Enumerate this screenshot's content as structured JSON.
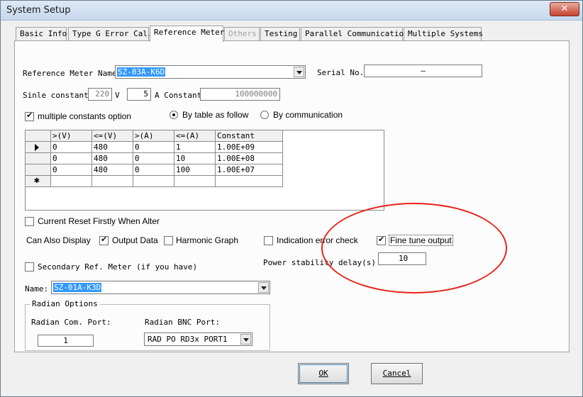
{
  "window": {
    "title": "System Setup",
    "close_symbol": "✕"
  },
  "tabs": [
    {
      "label": "Basic Info",
      "state": "normal"
    },
    {
      "label": "Type G Error Cal.",
      "state": "normal"
    },
    {
      "label": "Reference Meter",
      "state": "active"
    },
    {
      "label": "Others",
      "state": "disabled"
    },
    {
      "label": "Testing",
      "state": "normal"
    },
    {
      "label": "Parallel Communication",
      "state": "normal"
    },
    {
      "label": "Multiple Systems",
      "state": "normal"
    }
  ],
  "ref_meter": {
    "name_label": "Reference Meter Name",
    "name_value": "SZ-03A-K6D",
    "serial_label": "Serial No.",
    "serial_value": "—"
  },
  "constants": {
    "sinle_label": "Sinle constant",
    "v_value": "220",
    "v_unit": "V",
    "a_value": "5",
    "a_constant_label": "A Constant",
    "a_constant_value": "100000000"
  },
  "options": {
    "multiple_constants_label": "multiple constants option",
    "multiple_constants_checked": true,
    "by_table_label": "By table as follow",
    "by_table_selected": true,
    "by_comm_label": "By communication",
    "by_comm_selected": false
  },
  "table": {
    "headers": [
      ">(V)",
      "<=(V)",
      ">(A)",
      "<=(A)",
      "Constant"
    ],
    "rows": [
      [
        "0",
        "480",
        "0",
        "1",
        "1.00E+09"
      ],
      [
        "0",
        "480",
        "0",
        "10",
        "1.00E+08"
      ],
      [
        "0",
        "480",
        "0",
        "100",
        "1.00E+07"
      ]
    ],
    "new_row_marker": "✱"
  },
  "reset": {
    "label": "Current Reset Firstly When Alter",
    "checked": false
  },
  "display": {
    "can_also_display_label": "Can Also Display",
    "output_data_label": "Output Data",
    "output_data_checked": true,
    "harmonic_graph_label": "Harmonic Graph",
    "harmonic_graph_checked": false,
    "indication_error_label": "Indication error check",
    "indication_error_checked": false,
    "fine_tune_label": "Fine tune output",
    "fine_tune_checked": true
  },
  "power_stability": {
    "label": "Power stability delay(s)",
    "value": "10"
  },
  "secondary": {
    "label": "Secondary Ref. Meter (if you have)",
    "checked": false,
    "name_label": "Name:",
    "name_value": "SZ-01A-K3D"
  },
  "radian": {
    "group_title": "Radian Options",
    "com_port_label": "Radian Com. Port:",
    "com_port_value": "1",
    "bnc_port_label": "Radian BNC Port:",
    "bnc_port_value": "RAD PO RD3x PORT1"
  },
  "buttons": {
    "ok": "OK",
    "cancel": "Cancel"
  },
  "colors": {
    "annotation": "#e8241a",
    "selection": "#3399ff"
  }
}
